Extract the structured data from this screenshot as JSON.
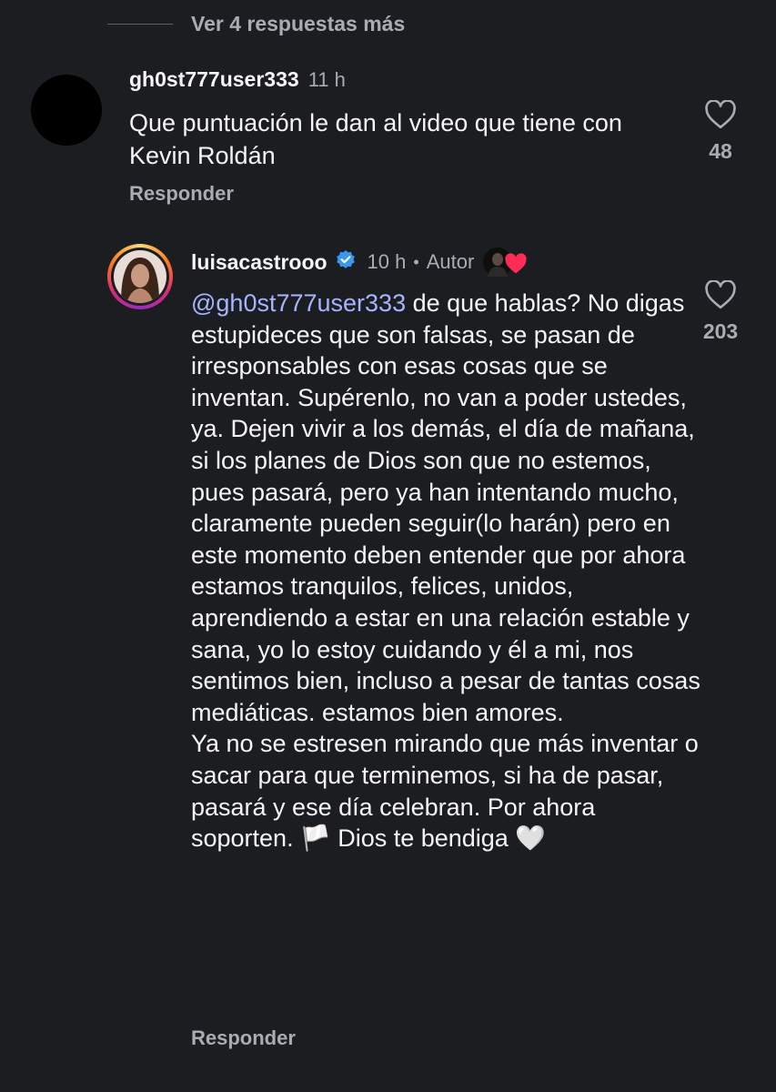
{
  "thread": {
    "more_replies_label": "Ver 4 respuestas más"
  },
  "comment1": {
    "username": "gh0st777user333",
    "time": "11 h",
    "text": "Que puntuación le dan al video que tiene con Kevin Roldán",
    "reply_label": "Responder",
    "like_count": "48"
  },
  "comment2": {
    "username": "luisacastrooo",
    "time": "10 h",
    "separator": "•",
    "author_label": "Autor",
    "mention": "@gh0st777user333",
    "text_after_mention": " de que hablas? No digas estupideces que son falsas, se pasan de irresponsables con esas cosas que se inventan. Supérenlo, no van a poder ustedes, ya. Dejen vivir a los demás, el día de mañana, si los planes de Dios son que no estemos, pues pasará, pero ya han intentando mucho, claramente pueden seguir(lo harán) pero en este momento deben entender que por ahora estamos tranquilos, felices, unidos, aprendiendo a estar en una relación estable y sana, yo lo estoy cuidando y él a mi, nos sentimos bien, incluso a pesar de tantas cosas mediáticas. estamos bien amores.\nYa no se estresen mirando que más inventar o  sacar para que terminemos, si ha de pasar, pasará y ese día celebran. Por ahora soporten. 🏳️ Dios te bendiga 🤍",
    "reply_label": "Responder",
    "like_count": "203"
  },
  "icons": {
    "like": "heart-outline-icon",
    "verified": "verified-badge-icon",
    "liked_by_author": "heart-filled-icon"
  },
  "colors": {
    "background": "#1b1d21",
    "text": "#f5f5f5",
    "secondary_text": "#a9adb3",
    "mention": "#a7b5ff",
    "verified": "#3897f0",
    "heart_red": "#ff2d55"
  }
}
